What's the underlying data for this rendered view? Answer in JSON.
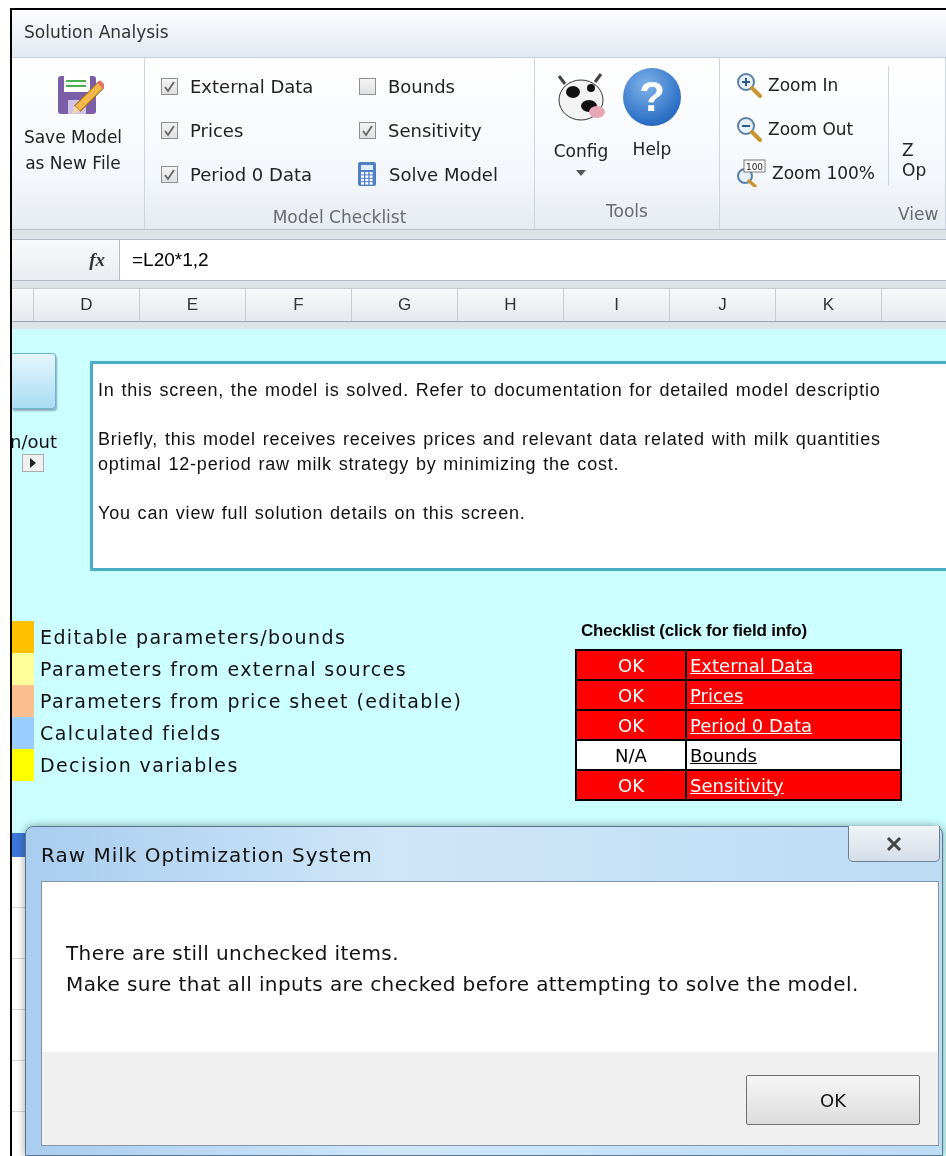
{
  "window": {
    "title": "Solution Analysis"
  },
  "ribbon": {
    "save_button": {
      "label": "Save Model as New File"
    },
    "checklist_group": {
      "label": "Model Checklist",
      "items": [
        {
          "kind": "checkbox",
          "label": "External Data",
          "checked": true
        },
        {
          "kind": "checkbox",
          "label": "Prices",
          "checked": true
        },
        {
          "kind": "checkbox",
          "label": "Period 0 Data",
          "checked": true
        },
        {
          "kind": "checkbox",
          "label": "Bounds",
          "checked": false
        },
        {
          "kind": "checkbox",
          "label": "Sensitivity",
          "checked": true
        },
        {
          "kind": "calculator",
          "label": "Solve Model"
        }
      ]
    },
    "tools_group": {
      "label": "Tools",
      "buttons": [
        {
          "kind": "cow",
          "label": "Config",
          "dropdown": true
        },
        {
          "kind": "help",
          "label": "Help",
          "glyph": "?"
        }
      ]
    },
    "view_group": {
      "label": "View",
      "buttons": [
        {
          "kind": "zoom-in",
          "label": "Zoom In"
        },
        {
          "kind": "zoom-out",
          "label": "Zoom Out"
        },
        {
          "kind": "zoom-100",
          "label": "Zoom 100%",
          "icon_text": "100"
        }
      ],
      "cut_button": {
        "lines": [
          "Z",
          "Op"
        ]
      }
    }
  },
  "formula_bar": {
    "fx": "fx",
    "formula": "=L20*1,2"
  },
  "columns": [
    "",
    "D",
    "E",
    "F",
    "G",
    "H",
    "I",
    "J",
    "K",
    ""
  ],
  "sheet": {
    "side_label": "n/out",
    "description": [
      [
        "In this screen, the model is solved. Refer to documentation for detailed model descriptio"
      ],
      [
        "Briefly, this model receives receives prices and relevant data related with milk quantities",
        "optimal 12-period raw milk strategy by minimizing the cost."
      ],
      [
        "You can view full solution details on this screen."
      ]
    ],
    "legend": [
      {
        "label": "Editable parameters/bounds",
        "color": "#ffc000"
      },
      {
        "label": "Parameters from external sources",
        "color": "#ffff99"
      },
      {
        "label": "Parameters from price sheet (editable)",
        "color": "#fac090"
      },
      {
        "label": "Calculated fields",
        "color": "#99ccff"
      },
      {
        "label": "Decision variables",
        "color": "#ffff00"
      }
    ],
    "checklist": {
      "title": "Checklist (click for field info)",
      "rows": [
        {
          "status": "OK",
          "link": "External Data",
          "color": "#ff0000"
        },
        {
          "status": "OK",
          "link": "Prices",
          "color": "#ff0000"
        },
        {
          "status": "OK",
          "link": "Period 0 Data",
          "color": "#ff0000"
        },
        {
          "status": "N/A",
          "link": "Bounds",
          "color": "#ffffff"
        },
        {
          "status": "OK",
          "link": "Sensitivity",
          "color": "#ff0000"
        }
      ]
    }
  },
  "dialog": {
    "title": "Raw Milk Optimization System",
    "message": [
      "There are still unchecked items.",
      "Make sure that all inputs are checked before attempting to solve the model."
    ],
    "buttons": [
      "OK"
    ]
  }
}
